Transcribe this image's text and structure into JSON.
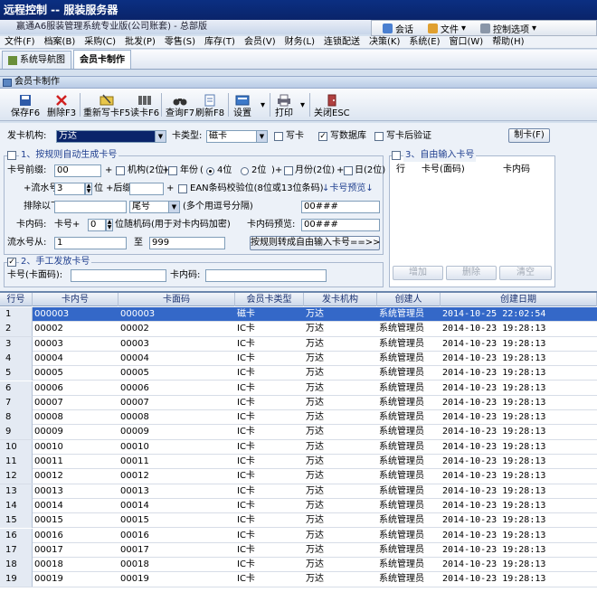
{
  "window": {
    "remote_title": "远程控制 -- 服装服务器",
    "app_title": "赢通A6服装管理系统专业版(公司账套) - 总部版",
    "remote_bar": {
      "chat": "会话",
      "file": "文件",
      "control": "控制选项"
    }
  },
  "menu": [
    "文件(F)",
    "档案(B)",
    "采购(C)",
    "批发(P)",
    "零售(S)",
    "库存(T)",
    "会员(V)",
    "财务(L)",
    "连锁配送",
    "决策(K)",
    "系统(E)",
    "窗口(W)",
    "帮助(H)"
  ],
  "tabs": [
    {
      "label": "系统导航图"
    },
    {
      "label": "会员卡制作"
    }
  ],
  "subheader": "会员卡制作",
  "toolbar": {
    "save": "保存F6",
    "delete": "删除F3",
    "rewrite": "重新写卡F5",
    "read": "读卡F6",
    "query": "查询F7",
    "refresh": "刷新F8",
    "settings": "设置",
    "print": "打印",
    "close": "关闭ESC"
  },
  "form": {
    "issuer_label": "发卡机构:",
    "issuer_value": "万达",
    "type_label": "卡类型:",
    "type_value": "磁卡",
    "write_card": "写卡",
    "write_db": "写数据库",
    "verify_after": "写卡后验证",
    "make_card_btn": "制卡(F)",
    "rule_group": "1、按规则自动生成卡号",
    "prefix_label": "卡号前缀:",
    "prefix_value": "00",
    "org_label": "机构(2位)",
    "year_label": "年份",
    "year4": "4位",
    "year2": "2位",
    "month_label": "月份(2位)",
    "day_label": "日(2位)",
    "serial_label": "+流水号",
    "serial_value": "3",
    "serial_unit": "位",
    "suffix_label": "+后缀",
    "ean_label": "EAN条码校验位(8位或13位条码)",
    "preview_link": "↓卡号预览↓",
    "preview_value": "00###",
    "exclude_label": "排除以下:",
    "exclude_mode": "尾号",
    "exclude_hint": "(多个用逗号分隔)",
    "inner_label": "卡内码:",
    "inner_prefix_label": "卡号+",
    "inner_rand_value": "0",
    "inner_rand_label": "位随机码(用于对卡内码加密)",
    "inner_preview_label": "卡内码预览:",
    "inner_preview_value": "00###",
    "range_label": "流水号从:",
    "range_from": "1",
    "range_to_label": "至",
    "range_to": "999",
    "convert_btn": "按规则转成自由输入卡号==>>",
    "manual_group": "2、手工发放卡号",
    "face_label": "卡号(卡面码):",
    "inner_code_label": "卡内码:",
    "free_group": "3、自由输入卡号",
    "free_cols": [
      "行",
      "卡号(面码)",
      "卡内码"
    ],
    "add_btn": "增加",
    "del_btn": "删除",
    "clear_btn": "清空"
  },
  "grid": {
    "columns": [
      "行号",
      "卡内号",
      "卡面码",
      "会员卡类型",
      "发卡机构",
      "创建人",
      "创建日期"
    ],
    "rows": [
      [
        "1",
        "000003",
        "000003",
        "磁卡",
        "万达",
        "系统管理员",
        "2014-10-25 22:02:54"
      ],
      [
        "2",
        "00002",
        "00002",
        "IC卡",
        "万达",
        "系统管理员",
        "2014-10-23 19:28:13"
      ],
      [
        "3",
        "00003",
        "00003",
        "IC卡",
        "万达",
        "系统管理员",
        "2014-10-23 19:28:13"
      ],
      [
        "4",
        "00004",
        "00004",
        "IC卡",
        "万达",
        "系统管理员",
        "2014-10-23 19:28:13"
      ],
      [
        "5",
        "00005",
        "00005",
        "IC卡",
        "万达",
        "系统管理员",
        "2014-10-23 19:28:13"
      ],
      [
        "6",
        "00006",
        "00006",
        "IC卡",
        "万达",
        "系统管理员",
        "2014-10-23 19:28:13"
      ],
      [
        "7",
        "00007",
        "00007",
        "IC卡",
        "万达",
        "系统管理员",
        "2014-10-23 19:28:13"
      ],
      [
        "8",
        "00008",
        "00008",
        "IC卡",
        "万达",
        "系统管理员",
        "2014-10-23 19:28:13"
      ],
      [
        "9",
        "00009",
        "00009",
        "IC卡",
        "万达",
        "系统管理员",
        "2014-10-23 19:28:13"
      ],
      [
        "10",
        "00010",
        "00010",
        "IC卡",
        "万达",
        "系统管理员",
        "2014-10-23 19:28:13"
      ],
      [
        "11",
        "00011",
        "00011",
        "IC卡",
        "万达",
        "系统管理员",
        "2014-10-23 19:28:13"
      ],
      [
        "12",
        "00012",
        "00012",
        "IC卡",
        "万达",
        "系统管理员",
        "2014-10-23 19:28:13"
      ],
      [
        "13",
        "00013",
        "00013",
        "IC卡",
        "万达",
        "系统管理员",
        "2014-10-23 19:28:13"
      ],
      [
        "14",
        "00014",
        "00014",
        "IC卡",
        "万达",
        "系统管理员",
        "2014-10-23 19:28:13"
      ],
      [
        "15",
        "00015",
        "00015",
        "IC卡",
        "万达",
        "系统管理员",
        "2014-10-23 19:28:13"
      ],
      [
        "16",
        "00016",
        "00016",
        "IC卡",
        "万达",
        "系统管理员",
        "2014-10-23 19:28:13"
      ],
      [
        "17",
        "00017",
        "00017",
        "IC卡",
        "万达",
        "系统管理员",
        "2014-10-23 19:28:13"
      ],
      [
        "18",
        "00018",
        "00018",
        "IC卡",
        "万达",
        "系统管理员",
        "2014-10-23 19:28:13"
      ],
      [
        "19",
        "00019",
        "00019",
        "IC卡",
        "万达",
        "系统管理员",
        "2014-10-23 19:28:13"
      ]
    ]
  },
  "colors": {
    "selection": "#3468c8",
    "title_bar": "#0a246a",
    "accent": "#1f3f8f"
  }
}
